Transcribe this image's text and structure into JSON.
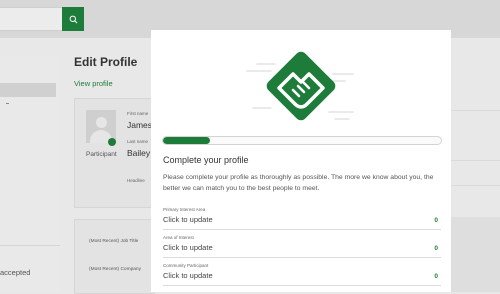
{
  "colors": {
    "brand": "#1d7c3a",
    "brand_light": "#3bb34a"
  },
  "topbar": {
    "search_icon": "search-icon"
  },
  "left": {
    "accepted_text": "accepted"
  },
  "page": {
    "title": "Edit Profile",
    "view_profile_link": "View profile",
    "profile": {
      "role": "Participant",
      "first_name_label": "First name",
      "first_name": "James",
      "last_name_label": "Last name",
      "last_name": "Bailey",
      "headline_label": "Headline"
    },
    "info": {
      "job_title_label": "(Most Recent) Job Title",
      "company_label": "(Most Recent) Company"
    }
  },
  "modal": {
    "illustration_icon": "handshake-icon",
    "progress": 0.17,
    "title": "Complete your profile",
    "description": "Please complete your profile as thoroughly as possible. The more we know about you, the better we can match you to the best people to meet.",
    "fields": [
      {
        "label": "Primary Interest Area",
        "value": "Click to update",
        "count": "0"
      },
      {
        "label": "Area of Interest",
        "value": "Click to update",
        "count": "0"
      },
      {
        "label": "Community Participant",
        "value": "Click to update",
        "count": "0"
      }
    ]
  }
}
